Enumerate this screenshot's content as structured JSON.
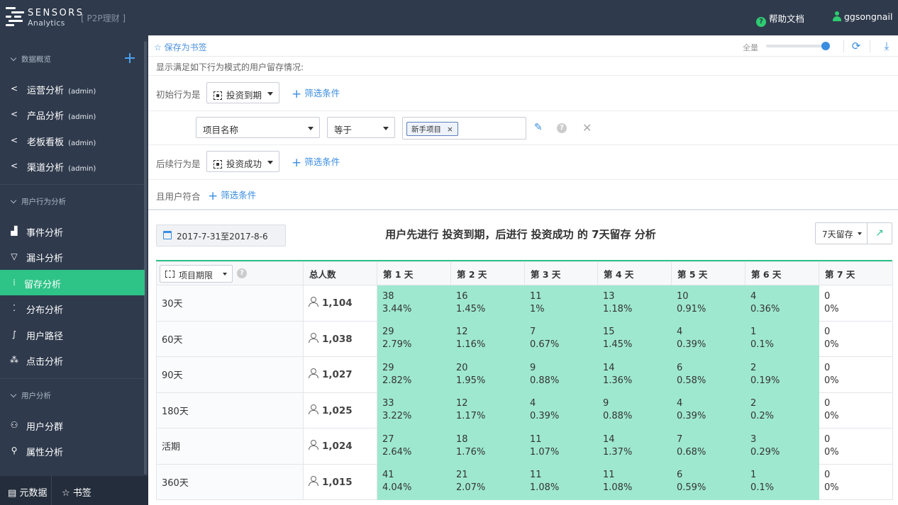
{
  "header": {
    "logo_line1": "SENSORS",
    "logo_line2": "Analytics",
    "project": "[ P2P理财 ]",
    "help_label": "帮助文档",
    "username": "ggsongnail"
  },
  "sidebar": {
    "groups": [
      {
        "label": "数据概览"
      },
      {
        "label": "用户行为分析"
      },
      {
        "label": "用户分析"
      }
    ],
    "dashboards": [
      {
        "label": "运营分析",
        "owner": "(admin)"
      },
      {
        "label": "产品分析",
        "owner": "(admin)"
      },
      {
        "label": "老板看板",
        "owner": "(admin)"
      },
      {
        "label": "渠道分析",
        "owner": "(admin)"
      }
    ],
    "behavior_items": [
      {
        "label": "事件分析",
        "icon": "bar-chart-icon"
      },
      {
        "label": "漏斗分析",
        "icon": "funnel-icon"
      },
      {
        "label": "留存分析",
        "icon": "retention-icon",
        "active": true
      },
      {
        "label": "分布分析",
        "icon": "distribution-icon"
      },
      {
        "label": "用户路径",
        "icon": "path-icon"
      },
      {
        "label": "点击分析",
        "icon": "click-icon"
      }
    ],
    "user_items": [
      {
        "label": "用户分群",
        "icon": "users-icon"
      },
      {
        "label": "属性分析",
        "icon": "attribute-icon"
      }
    ],
    "bottom": {
      "metadata_label": "元数据",
      "bookmark_label": "书签"
    }
  },
  "toolbar": {
    "save_bookmark": "保存为书签",
    "full_label": "全量",
    "sample_fraction": 1.0
  },
  "query": {
    "description": "显示满足如下行为模式的用户留存情况:",
    "initial_label": "初始行为是",
    "initial_event": "投资到期",
    "filter_label": "筛选条件",
    "filter_property": "项目名称",
    "filter_operator": "等于",
    "filter_value": "新手项目",
    "followup_label": "后续行为是",
    "followup_event": "投资成功",
    "user_label": "且用户符合"
  },
  "result": {
    "date_range": "2017-7-31至2017-8-6",
    "title": "用户先进行 投资到期，后进行 投资成功 的 7天留存 分析",
    "retention_select": "7天留存",
    "group_select": "项目期限",
    "headers": [
      "总人数",
      "第 1 天",
      "第 2 天",
      "第 3 天",
      "第 4 天",
      "第 5 天",
      "第 6 天",
      "第 7 天"
    ],
    "rows": [
      {
        "group": "30天",
        "total": "1,104",
        "cells": [
          [
            "38",
            "3.44%"
          ],
          [
            "16",
            "1.45%"
          ],
          [
            "11",
            "1%"
          ],
          [
            "13",
            "1.18%"
          ],
          [
            "10",
            "0.91%"
          ],
          [
            "4",
            "0.36%"
          ],
          [
            "0",
            "0%"
          ]
        ]
      },
      {
        "group": "60天",
        "total": "1,038",
        "cells": [
          [
            "29",
            "2.79%"
          ],
          [
            "12",
            "1.16%"
          ],
          [
            "7",
            "0.67%"
          ],
          [
            "15",
            "1.45%"
          ],
          [
            "4",
            "0.39%"
          ],
          [
            "1",
            "0.1%"
          ],
          [
            "0",
            "0%"
          ]
        ]
      },
      {
        "group": "90天",
        "total": "1,027",
        "cells": [
          [
            "29",
            "2.82%"
          ],
          [
            "20",
            "1.95%"
          ],
          [
            "9",
            "0.88%"
          ],
          [
            "14",
            "1.36%"
          ],
          [
            "6",
            "0.58%"
          ],
          [
            "2",
            "0.19%"
          ],
          [
            "0",
            "0%"
          ]
        ]
      },
      {
        "group": "180天",
        "total": "1,025",
        "cells": [
          [
            "33",
            "3.22%"
          ],
          [
            "12",
            "1.17%"
          ],
          [
            "4",
            "0.39%"
          ],
          [
            "9",
            "0.88%"
          ],
          [
            "4",
            "0.39%"
          ],
          [
            "2",
            "0.2%"
          ],
          [
            "0",
            "0%"
          ]
        ]
      },
      {
        "group": "活期",
        "total": "1,024",
        "cells": [
          [
            "27",
            "2.64%"
          ],
          [
            "18",
            "1.76%"
          ],
          [
            "11",
            "1.07%"
          ],
          [
            "14",
            "1.37%"
          ],
          [
            "7",
            "0.68%"
          ],
          [
            "3",
            "0.29%"
          ],
          [
            "0",
            "0%"
          ]
        ]
      },
      {
        "group": "360天",
        "total": "1,015",
        "cells": [
          [
            "41",
            "4.04%"
          ],
          [
            "21",
            "2.07%"
          ],
          [
            "11",
            "1.08%"
          ],
          [
            "11",
            "1.08%"
          ],
          [
            "6",
            "0.59%"
          ],
          [
            "1",
            "0.1%"
          ],
          [
            "0",
            "0%"
          ]
        ]
      }
    ]
  },
  "colors": {
    "sidebar_bg": "#2f3a4c",
    "accent_green": "#2ec387",
    "cell_green": "#9ee8cf",
    "link_blue": "#3a8de0"
  }
}
